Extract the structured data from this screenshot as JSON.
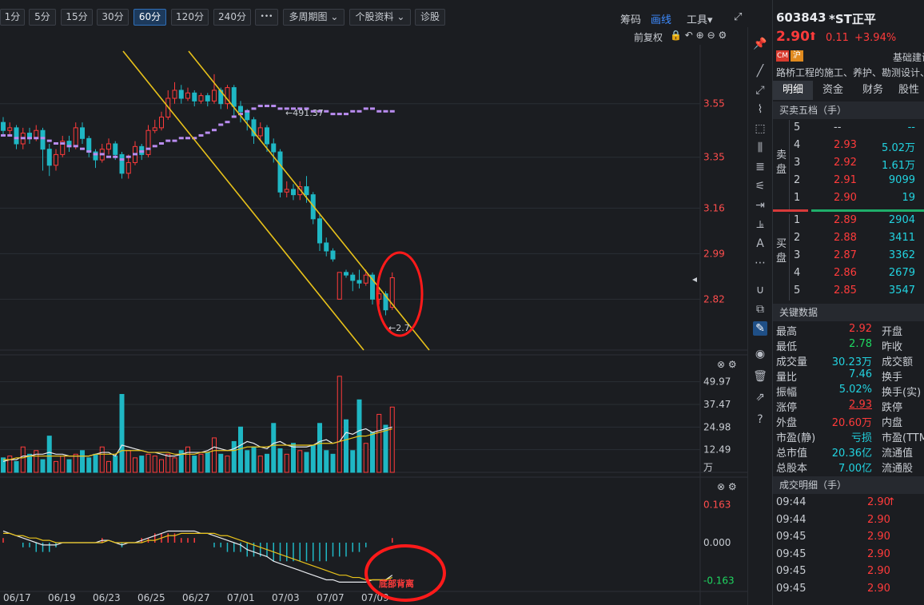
{
  "toolbar": {
    "periods": [
      "1分",
      "5分",
      "15分",
      "30分",
      "60分",
      "120分",
      "240分"
    ],
    "active_period": "60分",
    "more": "•••",
    "multi_period": "多周期图",
    "stock_info": "个股资料",
    "diagnose": "诊股",
    "chip": "筹码",
    "draw": "画线",
    "tools": "工具",
    "adjust": "前复权"
  },
  "stock": {
    "code": "603843",
    "name": "*ST正平",
    "price": "2.90",
    "change": "0.11",
    "change_pct": "+3.94%",
    "tag_cm": "CM",
    "tag_exchange": "沪",
    "industry": "基础建设",
    "desc": "路桥工程的施工、养护、勘测设计、"
  },
  "tabs": [
    "明细",
    "资金",
    "财务",
    "股性"
  ],
  "orderbook": {
    "title": "买卖五档（手）",
    "sell_label": "卖\n盘",
    "buy_label": "买\n盘",
    "sell": [
      {
        "level": "5",
        "price": "--",
        "vol": "--"
      },
      {
        "level": "4",
        "price": "2.93",
        "vol": "5.02万"
      },
      {
        "level": "3",
        "price": "2.92",
        "vol": "1.61万"
      },
      {
        "level": "2",
        "price": "2.91",
        "vol": "9099"
      },
      {
        "level": "1",
        "price": "2.90",
        "vol": "19"
      }
    ],
    "buy": [
      {
        "level": "1",
        "price": "2.89",
        "vol": "2904"
      },
      {
        "level": "2",
        "price": "2.88",
        "vol": "3411"
      },
      {
        "level": "3",
        "price": "2.87",
        "vol": "3362"
      },
      {
        "level": "4",
        "price": "2.86",
        "vol": "2679"
      },
      {
        "level": "5",
        "price": "2.85",
        "vol": "3547"
      }
    ]
  },
  "key_data": {
    "title": "关键数据",
    "rows": [
      {
        "l": "最高",
        "v": "2.92",
        "c": "red",
        "r": "开盘"
      },
      {
        "l": "最低",
        "v": "2.78",
        "c": "green",
        "r": "昨收"
      },
      {
        "l": "成交量",
        "v": "30.23万",
        "c": "cyan",
        "r": "成交额"
      },
      {
        "l": "量比",
        "v": "7.46",
        "c": "cyan",
        "r": "换手"
      },
      {
        "l": "振幅",
        "v": "5.02%",
        "c": "cyan",
        "r": "换手(实)"
      },
      {
        "l": "涨停",
        "v": "2.93",
        "c": "red",
        "r": "跌停"
      },
      {
        "l": "外盘",
        "v": "20.60万",
        "c": "red",
        "r": "内盘"
      },
      {
        "l": "市盈(静)",
        "v": "亏损",
        "c": "cyan",
        "r": "市盈(TTM)"
      },
      {
        "l": "总市值",
        "v": "20.36亿",
        "c": "cyan",
        "r": "流通值"
      },
      {
        "l": "总股本",
        "v": "7.00亿",
        "c": "cyan",
        "r": "流通股"
      }
    ]
  },
  "trades": {
    "title": "成交明细（手）",
    "rows": [
      {
        "t": "09:44",
        "p": "2.90",
        "arrow": "↑"
      },
      {
        "t": "09:44",
        "p": "2.90",
        "arrow": ""
      },
      {
        "t": "09:45",
        "p": "2.90",
        "arrow": ""
      },
      {
        "t": "09:45",
        "p": "2.90",
        "arrow": ""
      },
      {
        "t": "09:45",
        "p": "2.90",
        "arrow": ""
      },
      {
        "t": "09:45",
        "p": "2.90",
        "arrow": ""
      }
    ]
  },
  "chart_data": [
    {
      "type": "candlestick",
      "panel": "price",
      "y_ticks": [
        "3.55",
        "3.35",
        "3.16",
        "2.99",
        "2.82"
      ],
      "y_tick_values": [
        3.55,
        3.35,
        3.16,
        2.99,
        2.82
      ],
      "ylim": [
        2.63,
        3.77
      ],
      "high_label": "491.37",
      "low_label": "2.7",
      "ma_color": "#b98cf0",
      "channel_color": "#e8c21a",
      "up_color": "#ff3b3b",
      "down_color": "#1fb7c4",
      "candles": [
        [
          3.48,
          3.45,
          3.5,
          3.43
        ],
        [
          3.45,
          3.46,
          3.48,
          3.43
        ],
        [
          3.46,
          3.4,
          3.47,
          3.38
        ],
        [
          3.4,
          3.44,
          3.46,
          3.38
        ],
        [
          3.44,
          3.42,
          3.46,
          3.4
        ],
        [
          3.42,
          3.45,
          3.47,
          3.41
        ],
        [
          3.45,
          3.38,
          3.46,
          3.3
        ],
        [
          3.38,
          3.32,
          3.4,
          3.28
        ],
        [
          3.32,
          3.36,
          3.38,
          3.3
        ],
        [
          3.36,
          3.41,
          3.43,
          3.35
        ],
        [
          3.41,
          3.39,
          3.43,
          3.37
        ],
        [
          3.39,
          3.46,
          3.48,
          3.38
        ],
        [
          3.46,
          3.42,
          3.48,
          3.4
        ],
        [
          3.42,
          3.37,
          3.43,
          3.35
        ],
        [
          3.37,
          3.34,
          3.38,
          3.31
        ],
        [
          3.34,
          3.38,
          3.4,
          3.33
        ],
        [
          3.38,
          3.4,
          3.42,
          3.36
        ],
        [
          3.4,
          3.36,
          3.41,
          3.34
        ],
        [
          3.36,
          3.29,
          3.37,
          3.27
        ],
        [
          3.29,
          3.33,
          3.36,
          3.27
        ],
        [
          3.33,
          3.39,
          3.41,
          3.32
        ],
        [
          3.39,
          3.36,
          3.4,
          3.34
        ],
        [
          3.36,
          3.45,
          3.47,
          3.35
        ],
        [
          3.45,
          3.46,
          3.49,
          3.44
        ],
        [
          3.46,
          3.5,
          3.52,
          3.45
        ],
        [
          3.5,
          3.57,
          3.6,
          3.49
        ],
        [
          3.57,
          3.6,
          3.63,
          3.55
        ],
        [
          3.6,
          3.57,
          3.62,
          3.55
        ],
        [
          3.57,
          3.59,
          3.61,
          3.56
        ],
        [
          3.59,
          3.56,
          3.6,
          3.54
        ],
        [
          3.56,
          3.58,
          3.59,
          3.55
        ],
        [
          3.58,
          3.56,
          3.59,
          3.54
        ],
        [
          3.56,
          3.6,
          3.66,
          3.55
        ],
        [
          3.6,
          3.55,
          3.61,
          3.53
        ],
        [
          3.55,
          3.61,
          3.62,
          3.53
        ],
        [
          3.61,
          3.54,
          3.62,
          3.5
        ],
        [
          3.54,
          3.52,
          3.56,
          3.48
        ],
        [
          3.52,
          3.49,
          3.53,
          3.45
        ],
        [
          3.49,
          3.43,
          3.5,
          3.4
        ],
        [
          3.43,
          3.46,
          3.48,
          3.41
        ],
        [
          3.46,
          3.4,
          3.47,
          3.37
        ],
        [
          3.4,
          3.37,
          3.42,
          3.33
        ],
        [
          3.37,
          3.22,
          3.38,
          3.2
        ],
        [
          3.22,
          3.23,
          3.26,
          3.2
        ],
        [
          3.23,
          3.21,
          3.25,
          3.19
        ],
        [
          3.21,
          3.24,
          3.26,
          3.19
        ],
        [
          3.24,
          3.21,
          3.28,
          3.18
        ],
        [
          3.21,
          3.12,
          3.22,
          3.1
        ],
        [
          3.12,
          3.03,
          3.14,
          3.0
        ],
        [
          3.03,
          3.0,
          3.05,
          2.98
        ],
        [
          3.0,
          2.97,
          3.01,
          2.96
        ],
        [
          2.82,
          2.92,
          2.92,
          2.82
        ],
        [
          2.92,
          2.91,
          2.93,
          2.9
        ],
        [
          2.91,
          2.89,
          2.92,
          2.85
        ],
        [
          2.89,
          2.88,
          2.93,
          2.86
        ],
        [
          2.88,
          2.91,
          2.93,
          2.87
        ],
        [
          2.91,
          2.82,
          2.92,
          2.8
        ],
        [
          2.82,
          2.84,
          2.86,
          2.8
        ],
        [
          2.84,
          2.78,
          2.85,
          2.76
        ],
        [
          2.79,
          2.9,
          2.92,
          2.78
        ]
      ],
      "ma": [
        3.43,
        3.43,
        3.42,
        3.42,
        3.42,
        3.42,
        3.42,
        3.41,
        3.4,
        3.4,
        3.39,
        3.39,
        3.38,
        3.37,
        3.36,
        3.36,
        3.35,
        3.35,
        3.34,
        3.35,
        3.36,
        3.37,
        3.38,
        3.39,
        3.4,
        3.41,
        3.41,
        3.42,
        3.42,
        3.42,
        3.43,
        3.44,
        3.45,
        3.47,
        3.48,
        3.5,
        3.51,
        3.52,
        3.53,
        3.54,
        3.54,
        3.54,
        3.53,
        3.53,
        3.53,
        3.53,
        3.53,
        3.52,
        3.52,
        3.52,
        3.51,
        3.51,
        3.51,
        3.52,
        3.52,
        3.53,
        3.53,
        3.52,
        3.52,
        3.52
      ]
    },
    {
      "type": "bar",
      "panel": "volume",
      "unit": "万",
      "y_ticks": [
        "49.97",
        "37.47",
        "24.98",
        "12.49"
      ],
      "y_tick_values": [
        49.97,
        37.47,
        24.98,
        12.49
      ],
      "ylim": [
        0,
        56
      ],
      "values": [
        8,
        9,
        6,
        14,
        10,
        12,
        7,
        20,
        6,
        9,
        7,
        10,
        12,
        8,
        10,
        14,
        6,
        9,
        43,
        12,
        8,
        9,
        10,
        9,
        7,
        10,
        8,
        12,
        14,
        9,
        10,
        11,
        19,
        10,
        9,
        17,
        25,
        12,
        14,
        9,
        10,
        27,
        13,
        10,
        16,
        12,
        11,
        15,
        27,
        12,
        10,
        53,
        29,
        12,
        40,
        16,
        22,
        32,
        26,
        36
      ],
      "ma1": [
        6,
        7,
        7,
        9,
        9,
        10,
        10,
        11,
        10,
        10,
        9,
        9,
        9,
        9,
        10,
        11,
        11,
        9,
        15,
        14,
        13,
        12,
        11,
        11,
        10,
        9,
        9,
        10,
        11,
        11,
        11,
        12,
        14,
        13,
        12,
        13,
        15,
        17,
        16,
        14,
        13,
        16,
        17,
        15,
        14,
        14,
        14,
        15,
        17,
        18,
        16,
        17,
        22,
        21,
        23,
        24,
        22,
        23,
        24,
        25
      ],
      "ma2": [
        7,
        7,
        8,
        8,
        9,
        9,
        9,
        9,
        9,
        9,
        9,
        9,
        9,
        9,
        10,
        10,
        10,
        10,
        12,
        12,
        12,
        12,
        11,
        11,
        11,
        11,
        10,
        10,
        10,
        10,
        11,
        11,
        12,
        12,
        12,
        12,
        13,
        14,
        14,
        14,
        14,
        15,
        15,
        15,
        15,
        15,
        15,
        15,
        16,
        16,
        16,
        17,
        18,
        19,
        20,
        20,
        21,
        22,
        23,
        24
      ]
    },
    {
      "type": "macd",
      "panel": "indicator",
      "y_ticks": [
        "0.163",
        "0.000",
        "-0.163"
      ],
      "y_tick_values": [
        0.163,
        0,
        -0.163
      ],
      "ylim": [
        -0.21,
        0.21
      ],
      "x_labels": [
        "06/17",
        "06/19",
        "06/23",
        "06/25",
        "06/27",
        "07/01",
        "07/03",
        "07/07",
        "07/09"
      ],
      "annotation": "底部背离",
      "dif": [
        0.05,
        0.04,
        0.03,
        0.02,
        0.01,
        0.0,
        -0.01,
        -0.01,
        -0.01,
        0.0,
        0.0,
        0.0,
        0.0,
        0.0,
        0.0,
        0.01,
        0.01,
        0.0,
        -0.01,
        0.0,
        0.0,
        0.01,
        0.02,
        0.03,
        0.04,
        0.05,
        0.05,
        0.05,
        0.05,
        0.05,
        0.04,
        0.04,
        0.03,
        0.02,
        0.01,
        0.0,
        -0.01,
        -0.03,
        -0.04,
        -0.05,
        -0.06,
        -0.08,
        -0.09,
        -0.1,
        -0.11,
        -0.12,
        -0.13,
        -0.14,
        -0.15,
        -0.16,
        -0.16,
        -0.17,
        -0.17,
        -0.17,
        -0.17,
        -0.17,
        -0.16,
        -0.16,
        -0.16,
        -0.14
      ],
      "dea": [
        0.04,
        0.04,
        0.03,
        0.03,
        0.02,
        0.02,
        0.01,
        0.01,
        0.0,
        0.0,
        0.0,
        0.0,
        0.0,
        0.0,
        0.0,
        0.0,
        0.01,
        0.0,
        0.0,
        0.0,
        0.0,
        0.0,
        0.01,
        0.01,
        0.02,
        0.03,
        0.03,
        0.04,
        0.04,
        0.04,
        0.04,
        0.04,
        0.04,
        0.03,
        0.03,
        0.02,
        0.01,
        0.0,
        -0.01,
        -0.02,
        -0.03,
        -0.04,
        -0.05,
        -0.06,
        -0.07,
        -0.08,
        -0.09,
        -0.1,
        -0.11,
        -0.12,
        -0.13,
        -0.14,
        -0.14,
        -0.15,
        -0.15,
        -0.16,
        -0.16,
        -0.16,
        -0.16,
        -0.15
      ],
      "macd": [
        0.02,
        0.0,
        0.0,
        -0.02,
        -0.02,
        -0.04,
        -0.04,
        -0.04,
        -0.02,
        0.0,
        0.0,
        0.0,
        0.0,
        0.0,
        0.0,
        0.02,
        0.0,
        0.0,
        -0.02,
        0.0,
        0.0,
        0.02,
        0.02,
        0.04,
        0.04,
        0.04,
        0.04,
        0.02,
        0.02,
        0.02,
        0.0,
        0.0,
        -0.02,
        -0.02,
        -0.04,
        -0.04,
        -0.04,
        -0.06,
        -0.06,
        -0.06,
        -0.06,
        -0.08,
        -0.08,
        -0.08,
        -0.08,
        -0.08,
        -0.08,
        -0.08,
        -0.08,
        -0.08,
        -0.06,
        -0.06,
        -0.06,
        -0.04,
        -0.04,
        -0.02,
        0.0,
        0.0,
        0.0,
        0.02
      ]
    }
  ]
}
